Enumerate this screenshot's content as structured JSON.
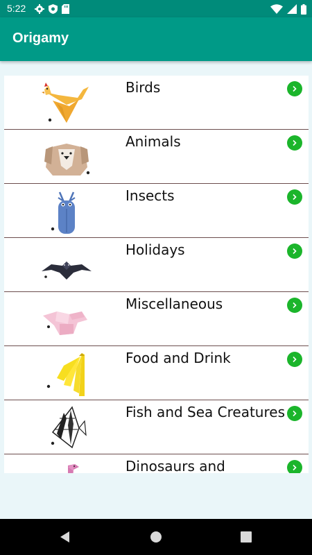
{
  "status_bar": {
    "time": "5:22",
    "left_icons": [
      "gear-icon",
      "shield-icon",
      "sd-card-icon"
    ],
    "right_icons": [
      "wifi-icon",
      "signal-icon",
      "battery-icon"
    ]
  },
  "app_bar": {
    "title": "Origamy"
  },
  "categories": [
    {
      "label": "Birds",
      "icon": "origami-bird-icon"
    },
    {
      "label": "Animals",
      "icon": "origami-dog-icon"
    },
    {
      "label": "Insects",
      "icon": "origami-beetle-icon"
    },
    {
      "label": "Holidays",
      "icon": "origami-bat-icon"
    },
    {
      "label": "Miscellaneous",
      "icon": "origami-pig-icon"
    },
    {
      "label": "Food and Drink",
      "icon": "origami-banana-icon"
    },
    {
      "label": "Fish and Sea Creatures",
      "icon": "origami-fish-icon"
    },
    {
      "label": "Dinosaurs and",
      "icon": "origami-dinosaur-icon"
    }
  ],
  "colors": {
    "status_bar": "#008b7a",
    "app_bar": "#009a87",
    "arrow_badge": "#1bb52b",
    "divider": "#6b4d4d"
  },
  "nav_bar": {
    "icons": [
      "back-icon",
      "home-icon",
      "recents-icon"
    ]
  }
}
